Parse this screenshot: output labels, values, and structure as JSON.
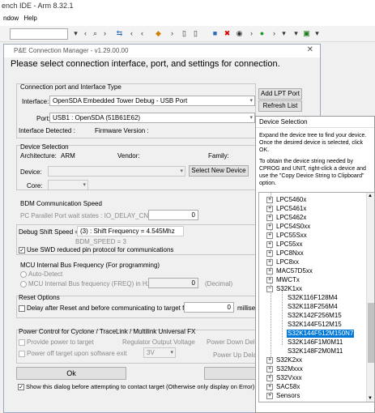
{
  "ide": {
    "title": "ench IDE - Arm 8.32.1",
    "menu": [
      "ndow",
      "Help"
    ]
  },
  "dialog": {
    "title": "P&E Connection Manager - v1.29.00.00",
    "heading": "Please select connection interface, port, and settings for connection.",
    "port_section_label": "Connection port and Interface Type",
    "interface_label": "Interface:",
    "interface_value": "OpenSDA Embedded Tower Debug - USB Port",
    "port_label": "Port:",
    "port_value": "USB1 : OpenSDA (51B61E62)",
    "add_lpt_button": "Add LPT Port",
    "refresh_button": "Refresh List",
    "interface_detected_label": "Interface Detected :",
    "firmware_version_label": "Firmware Version :",
    "device_section_label": "Device Selection",
    "architecture_label": "Architecture:",
    "architecture_value": "ARM",
    "vendor_label": "Vendor:",
    "family_label": "Family:",
    "device_label": "Device:",
    "select_device_button": "Select New Device",
    "core_label": "Core:",
    "bdm_label": "BDM Communication Speed",
    "pc_parallel_label": "PC Parallel Port wait states : IO_DELAY_CNT =",
    "pc_parallel_value": "0",
    "debug_shift_label": "Debug Shift Speed =",
    "debug_shift_value": "(3)  :  Shift Frequency =  4.545Mhz",
    "bdm_speed_label": "BDM_SPEED = 3",
    "swd_label": "Use SWD reduced pin protocol for communications",
    "swd_checked": true,
    "mcu_freq_label": "MCU Internal Bus Frequency (For programming)",
    "auto_detect_label": "Auto-Detect",
    "mcu_freq_radio_label": "MCU Internal Bus frequency (FREQ) in Hz =",
    "mcu_freq_value": "0",
    "decimal_label": "(Decimal)",
    "reset_label": "Reset Options",
    "delay_after_reset_label": "Delay after Reset and before communicating to target for",
    "delay_value": "0",
    "delay_unit": "milliseco",
    "power_label": "Power Control for Cyclone / TraceLink / Multilink Universal FX",
    "provide_power_label": "Provide power to target",
    "regulator_label": "Regulator Output Voltage",
    "power_down_label": "Power Down Dela",
    "power_off_label": "Power off target upon software exit",
    "voltage_value": "3V",
    "power_up_label": "Power Up Dela",
    "ok_button": "Ok",
    "cancel_button": "Ca",
    "show_dialog_label": "Show this dialog before attempting to contact target (Otherwise only display on Error)",
    "show_dialog_checked": true
  },
  "device_selection": {
    "title": "Device Selection",
    "intro": "Expand the device tree to find your device. Once the desired device is selected, click OK.",
    "hint": "To obtain the device string needed by CPROG and UNIT, right-click a device and use the \"Copy Device String to Clipboard\" option.",
    "tree": [
      {
        "label": "LPC5460x",
        "indent": 0,
        "exp": "+"
      },
      {
        "label": "LPC5461x",
        "indent": 0,
        "exp": "+"
      },
      {
        "label": "LPC5462x",
        "indent": 0,
        "exp": "+"
      },
      {
        "label": "LPC54S0xx",
        "indent": 0,
        "exp": "+"
      },
      {
        "label": "LPC55Sxx",
        "indent": 0,
        "exp": "+"
      },
      {
        "label": "LPC55xx",
        "indent": 0,
        "exp": "+"
      },
      {
        "label": "LPC8Nxx",
        "indent": 0,
        "exp": "+"
      },
      {
        "label": "LPC8xx",
        "indent": 0,
        "exp": "+"
      },
      {
        "label": "MAC57D5xx",
        "indent": 0,
        "exp": "+"
      },
      {
        "label": "MWCTx",
        "indent": 0,
        "exp": "+"
      },
      {
        "label": "S32K1xx",
        "indent": 0,
        "exp": "-"
      },
      {
        "label": "S32K116F128M4",
        "indent": 1,
        "exp": ""
      },
      {
        "label": "S32K118F256M4",
        "indent": 1,
        "exp": ""
      },
      {
        "label": "S32K142F256M15",
        "indent": 1,
        "exp": ""
      },
      {
        "label": "S32K144F512M15",
        "indent": 1,
        "exp": ""
      },
      {
        "label": "S32K144F512M150N7",
        "indent": 1,
        "exp": "",
        "selected": true
      },
      {
        "label": "S32K146F1M0M11",
        "indent": 1,
        "exp": ""
      },
      {
        "label": "S32K148F2M0M11",
        "indent": 1,
        "exp": ""
      },
      {
        "label": "S32K2xx",
        "indent": 0,
        "exp": "+"
      },
      {
        "label": "S32Mxxx",
        "indent": 0,
        "exp": "+"
      },
      {
        "label": "S32Vxxx",
        "indent": 0,
        "exp": "+"
      },
      {
        "label": "SAC58x",
        "indent": 0,
        "exp": "+"
      },
      {
        "label": "Sensors",
        "indent": 0,
        "exp": "+"
      }
    ]
  },
  "colors": {
    "selection": "#0078d7",
    "dialog_bg": "#f0f0f0"
  }
}
